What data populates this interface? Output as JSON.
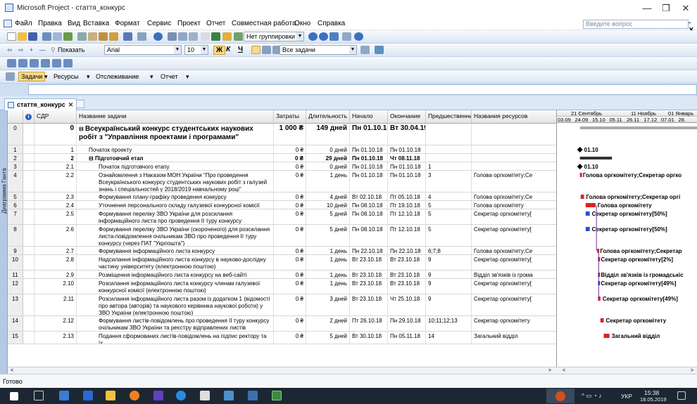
{
  "window": {
    "title": "Microsoft Project - стаття_конкурс",
    "min": "—",
    "max": "❐",
    "close": "✕"
  },
  "menu": [
    "Файл",
    "Правка",
    "Вид",
    "Вставка",
    "Формат",
    "Сервис",
    "Проект",
    "Отчет",
    "Совместная работа",
    "Окно",
    "Справка"
  ],
  "help_placeholder": "Введите вопрос",
  "toolbar1": {
    "grouping": "Нет группировки"
  },
  "toolbar2": {
    "show": "Показать",
    "font": "Arial",
    "size": "10",
    "bold": "Ж",
    "italic": "К",
    "underline": "Ч",
    "filter": "Все задачи"
  },
  "toolbar4": {
    "tasks": "Задачи",
    "resources": "Ресурсы",
    "tracking": "Отслеживание",
    "report": "Отчет"
  },
  "tab": {
    "label": "стаття_конкурс"
  },
  "view_label": "Диаграмма Ганта",
  "columns": [
    "СДР",
    "Название задачи",
    "Затраты",
    "Длительность",
    "Начало",
    "Окончание",
    "Предшественники",
    "Названия ресурсов"
  ],
  "gantt_header": {
    "top": [
      "21 Сентябрь",
      "11 Ноябрь",
      "01 Январь"
    ],
    "bottom": [
      "03.09",
      "24.09",
      "15.10",
      "05.11",
      "26.11",
      "17.12",
      "07.01",
      "28."
    ]
  },
  "rows": [
    {
      "id": "0",
      "wbs": "0",
      "name": "Всеукраїнський конкурс студентських наукових робіт з \"Управління проектами і програмами\"",
      "cost": "1 000 ₴",
      "dur": "149 дней",
      "start": "Пн 01.10.18",
      "end": "Вт 30.04.19",
      "pred": "",
      "res": "",
      "sum": true,
      "big": true
    },
    {
      "id": "1",
      "wbs": "1",
      "name": "Початок проекту",
      "cost": "0 ₴",
      "dur": "0 дней",
      "start": "Пн 01.10.18",
      "end": "Пн 01.10.18",
      "pred": "",
      "res": "",
      "ms": "01.10"
    },
    {
      "id": "2",
      "wbs": "2",
      "name": "Підготовчий етап",
      "cost": "0 ₴",
      "dur": "29 дней",
      "start": "Пн 01.10.18",
      "end": "Чт 08.11.18",
      "pred": "",
      "res": "",
      "sum": true
    },
    {
      "id": "3",
      "wbs": "2.1",
      "name": "Початок підготовчого етапу",
      "cost": "0 ₴",
      "dur": "0 дней",
      "start": "Пн 01.10.18",
      "end": "Пн 01.10.18",
      "pred": "1",
      "res": "",
      "ms": "01.10"
    },
    {
      "id": "4",
      "wbs": "2.2",
      "name": "Ознайомлення з Наказом МОН України \"Про проведення Всеукраїнського конкурсу студентських наукових робіт з галузей знань і спеціальностей у 2018/2019 навчальному році\"",
      "cost": "0 ₴",
      "dur": "1 день",
      "start": "Пн 01.10.18",
      "end": "Пн 01.10.18",
      "pred": "3",
      "res": "Голова оргкомітету;Се",
      "gl": "Голова оргкомітету;Секретар оргко"
    },
    {
      "id": "5",
      "wbs": "2.3",
      "name": "Формування плану-графіку проведення конкурсу",
      "cost": "0 ₴",
      "dur": "4 дней",
      "start": "Вт 02.10.18",
      "end": "Пт 05.10.18",
      "pred": "4",
      "res": "Голова оргкомітету;Се",
      "gl": "Голова оргкомітету;Секретар оргі"
    },
    {
      "id": "6",
      "wbs": "2.4",
      "name": "Уточнення персонального складу галузевої конкурсної комісії",
      "cost": "0 ₴",
      "dur": "10 дней",
      "start": "Пн 08.10.18",
      "end": "Пт 19.10.18",
      "pred": "5",
      "res": "Голова оргкомітету",
      "gl": "Голова оргкомітету"
    },
    {
      "id": "7",
      "wbs": "2.5",
      "name": "Формування переліку ЗВО України для розсилання інформаційного листа про проведення ІІ туру конкурсу (електронною поштою)",
      "cost": "0 ₴",
      "dur": "5 дней",
      "start": "Пн 08.10.18",
      "end": "Пт 12.10.18",
      "pred": "5",
      "res": "Секретар оргкомітету[",
      "gl": "Секретар оргкомітету[50%]"
    },
    {
      "id": "8",
      "wbs": "2.6",
      "name": "Формування переліку ЗВО України (скороченого) для розсилання листа-повідомлення очільникам ЗВО про проведення ІІ туру конкурсу (через ПАТ \"Укрпошта\")",
      "cost": "0 ₴",
      "dur": "5 дней",
      "start": "Пн 08.10.18",
      "end": "Пт 12.10.18",
      "pred": "5",
      "res": "Секретар оргкомітету[",
      "gl": "Секретар оргкомітету[50%]"
    },
    {
      "id": "9",
      "wbs": "2.7",
      "name": "Формування інформаційного листа конкурсу",
      "cost": "0 ₴",
      "dur": "1 день",
      "start": "Пн 22.10.18",
      "end": "Пн 22.10.18",
      "pred": "6;7;8",
      "res": "Голова оргкомітету;Се",
      "gl": "Голова оргкомітету;Секретар"
    },
    {
      "id": "10",
      "wbs": "2.8",
      "name": "Надсилання інформаційного листа конкурсу в науково-дослідну частину університету (електронною поштою)",
      "cost": "0 ₴",
      "dur": "1 день",
      "start": "Вт 23.10.18",
      "end": "Вт 23.10.18",
      "pred": "9",
      "res": "Секретар оргкомітету[",
      "gl": "Секретар оргкомітету[2%]"
    },
    {
      "id": "11",
      "wbs": "2.9",
      "name": "Розміщення інформаційного листа конкурсу на веб-сайті університе",
      "cost": "0 ₴",
      "dur": "1 день",
      "start": "Вт 23.10.18",
      "end": "Вт 23.10.18",
      "pred": "9",
      "res": "Відділ зв'язків із грома",
      "gl": "Відділ зв'язків із громадськіс"
    },
    {
      "id": "12",
      "wbs": "2.10",
      "name": "Розсилання інформаційного листа конкурсу членам галузевої конкурсної комісії (електронною поштою)",
      "cost": "0 ₴",
      "dur": "1 день",
      "start": "Вт 23.10.18",
      "end": "Вт 23.10.18",
      "pred": "9",
      "res": "Секретар оргкомітету[",
      "gl": "Секретар оргкомітету[49%]"
    },
    {
      "id": "13",
      "wbs": "2.11",
      "name": "Розсилання інформаційного листа разом із додатком 1 (відомості про автора (авторів) та наукового керівника наукової роботи) у ЗВО України (електронною поштою)",
      "cost": "0 ₴",
      "dur": "3 дней",
      "start": "Вт 23.10.18",
      "end": "Чт 25.10.18",
      "pred": "9",
      "res": "Секретар оргкомітету[",
      "gl": "Секретар оргкомітету[49%]"
    },
    {
      "id": "14",
      "wbs": "2.12",
      "name": "Формування листів-повідомлень про проведення ІІ туру конкурсу очільникам ЗВО України та реєстру відправлених листів",
      "cost": "0 ₴",
      "dur": "2 дней",
      "start": "Пт 26.10.18",
      "end": "Пн 29.10.18",
      "pred": "10;11;12;13",
      "res": "Секретар оргкомітету",
      "gl": "Секретар оргкомітету"
    },
    {
      "id": "15",
      "wbs": "2.13",
      "name": "Подання сформованих листів-повідомлень на підпис ректору та їх",
      "cost": "0 ₴",
      "dur": "5 дней",
      "start": "Вт 30.10.18",
      "end": "Пн 05.11.18",
      "pred": "14",
      "res": "Загальний відділ",
      "gl": "Загальний відділ"
    }
  ],
  "status": "Готово",
  "tray": {
    "lang": "УКР",
    "time": "15:38",
    "date": "18.05.2019"
  },
  "colors": {
    "toolbar": "#dbe6f4",
    "bar_red": "#e02020",
    "bar_blue": "#2450d0",
    "link": "#7030a0"
  }
}
